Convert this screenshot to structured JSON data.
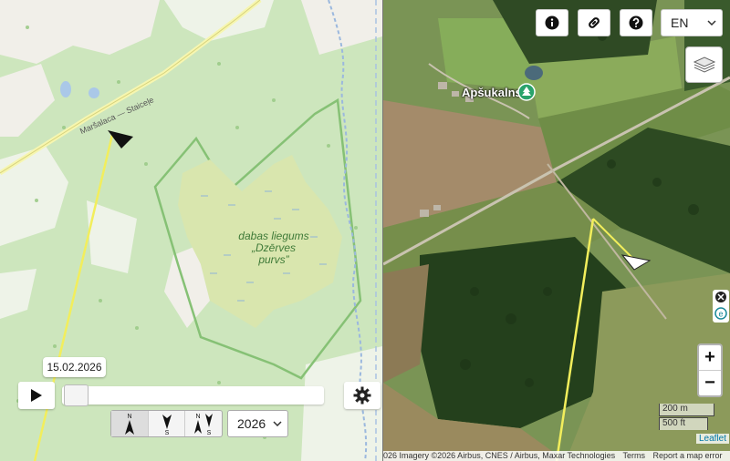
{
  "left_map": {
    "road_label": "Maršalaca — Staiceļe",
    "reserve_label": [
      "dabas liegums",
      "„Dzērves",
      "purvs”"
    ]
  },
  "right_map": {
    "poi_label": "Apšukalns",
    "poi_icon": "tree-icon"
  },
  "top_controls": {
    "info_icon": "info-icon",
    "link_icon": "link-icon",
    "help_icon": "help-icon",
    "language": "EN",
    "layers_icon": "layers-icon"
  },
  "zoom": {
    "in_label": "+",
    "out_label": "−"
  },
  "scale": {
    "metric": "200 m",
    "imperial": "500 ft"
  },
  "attribution": {
    "imagery": "026 Imagery ©2026 Airbus, CNES / Airbus, Maxar Technologies",
    "terms": "Terms",
    "report": "Report a map error",
    "leaflet": "Leaflet"
  },
  "timeline": {
    "date": "15.02.2026",
    "year": "2026",
    "slider_position": 0.02,
    "direction_buttons": [
      {
        "name": "north-arrow",
        "label": "N"
      },
      {
        "name": "south-arrow",
        "label": "S"
      },
      {
        "name": "north-south-arrow",
        "label": "N S"
      }
    ]
  },
  "colors": {
    "track": "#f2ee5c",
    "forest": "#a9d39a",
    "reserve_border": "#7bbd6a"
  }
}
